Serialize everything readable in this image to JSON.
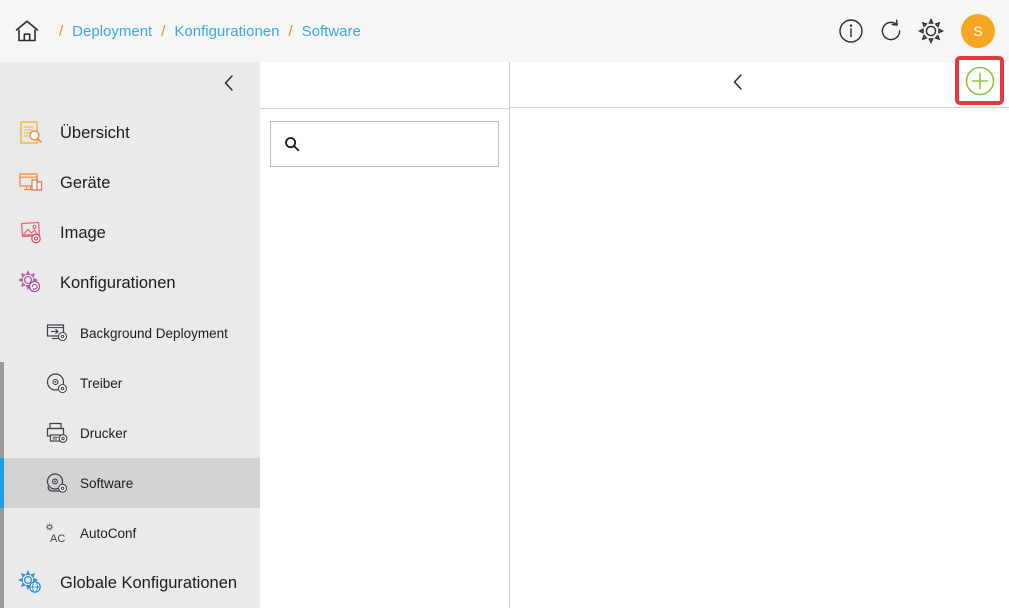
{
  "topbar": {
    "home_icon": "home-icon",
    "breadcrumb": {
      "separator": "/",
      "items": [
        {
          "label": "Deployment"
        },
        {
          "label": "Konfigurationen"
        },
        {
          "label": "Software"
        }
      ]
    },
    "actions": [
      {
        "name": "info-icon",
        "label": "i"
      },
      {
        "name": "refresh-icon",
        "label": ""
      },
      {
        "name": "gear-icon",
        "label": ""
      }
    ],
    "avatar": {
      "initial": "S",
      "color": "#f5a623"
    }
  },
  "sidebar": {
    "collapse_icon": "chevron-left-icon",
    "background": "#eaeaea",
    "selected_accent": "#1a9fe0",
    "selected_background": "#d3d3d3",
    "items": [
      {
        "label": "Übersicht",
        "icon": "overview-icon",
        "level": "top",
        "selected": false
      },
      {
        "label": "Geräte",
        "icon": "devices-icon",
        "level": "top",
        "selected": false
      },
      {
        "label": "Image",
        "icon": "image-icon",
        "level": "top",
        "selected": false
      },
      {
        "label": "Konfigurationen",
        "icon": "configurations-gear-icon",
        "level": "top",
        "selected": false
      },
      {
        "label": "Background Deployment",
        "icon": "background-deployment-icon",
        "level": "sub",
        "selected": false
      },
      {
        "label": "Treiber",
        "icon": "driver-disc-icon",
        "level": "sub",
        "selected": false
      },
      {
        "label": "Drucker",
        "icon": "printer-icon",
        "level": "sub",
        "selected": false
      },
      {
        "label": "Software",
        "icon": "software-disc-icon",
        "level": "sub",
        "selected": true
      },
      {
        "label": "AutoConf",
        "icon": "autoconf-icon",
        "level": "sub",
        "selected": false
      },
      {
        "label": "Globale Konfigurationen",
        "icon": "global-configurations-icon",
        "level": "top",
        "selected": false
      }
    ]
  },
  "list_panel": {
    "search": {
      "value": "",
      "placeholder": "",
      "icon": "search-icon"
    }
  },
  "content": {
    "back_icon": "chevron-left-icon",
    "add_button": {
      "name": "add-button",
      "icon": "plus-circle-icon",
      "circle_color": "#8dc63f",
      "highlight_color": "#e8383d"
    }
  }
}
